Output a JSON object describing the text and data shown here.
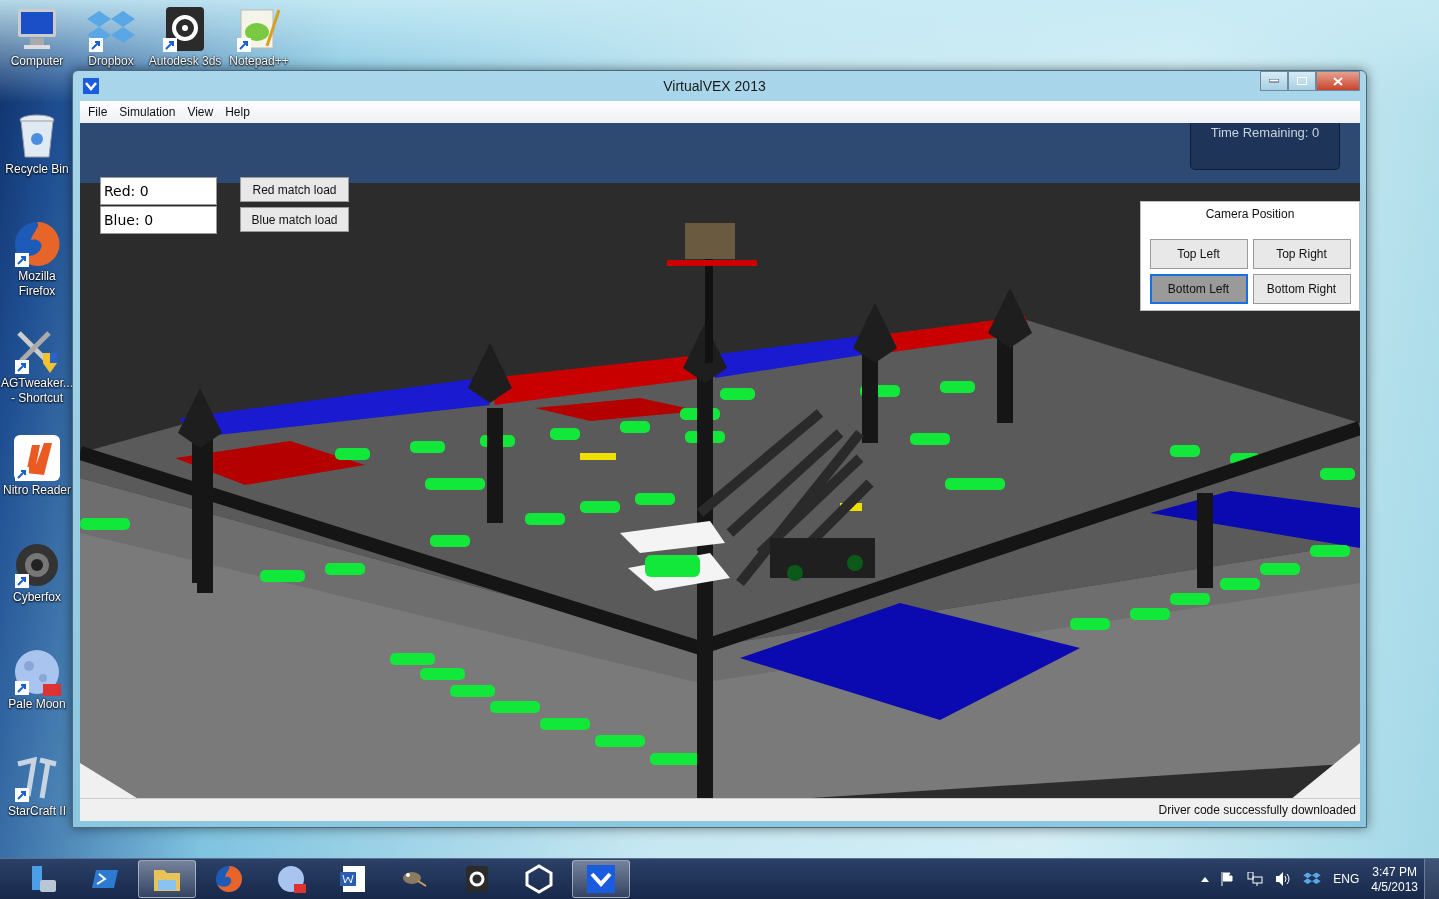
{
  "desktop": {
    "top_icons": [
      {
        "label": "Computer",
        "kind": "computer",
        "shortcut": false
      },
      {
        "label": "Dropbox",
        "kind": "dropbox",
        "shortcut": true
      },
      {
        "label": "Autodesk 3ds",
        "kind": "max3ds",
        "shortcut": true
      },
      {
        "label": "Notepad++",
        "kind": "notepad",
        "shortcut": true
      }
    ],
    "side_icons": [
      {
        "label": "Recycle Bin",
        "kind": "recycle",
        "shortcut": false
      },
      {
        "label": "Mozilla Firefox",
        "kind": "firefox",
        "shortcut": true
      },
      {
        "label": "AGTweaker... - Shortcut",
        "kind": "tools",
        "shortcut": true
      },
      {
        "label": "Nitro Reader",
        "kind": "nitro",
        "shortcut": true
      },
      {
        "label": "Cyberfox",
        "kind": "cyberfox",
        "shortcut": true
      },
      {
        "label": "Pale Moon",
        "kind": "moon",
        "shortcut": true
      },
      {
        "label": "StarCraft II",
        "kind": "starcraft",
        "shortcut": true
      }
    ]
  },
  "window": {
    "title": "VirtualVEX 2013",
    "menu": [
      "File",
      "Simulation",
      "View",
      "Help"
    ],
    "scores": [
      "Red: 0",
      "Blue: 0"
    ],
    "load_buttons": [
      "Red match load",
      "Blue match load"
    ],
    "timer": "Time Remaining: 0",
    "camera": {
      "title": "Camera Position",
      "buttons": [
        {
          "label": "Top Left",
          "selected": false
        },
        {
          "label": "Top Right",
          "selected": false
        },
        {
          "label": "Bottom Left",
          "selected": true
        },
        {
          "label": "Bottom Right",
          "selected": false
        }
      ]
    },
    "status": "Driver code successfully downloaded"
  },
  "taskbar": {
    "items": [
      {
        "kind": "server",
        "active": false
      },
      {
        "kind": "shell",
        "active": false
      },
      {
        "kind": "folder",
        "active": true
      },
      {
        "kind": "firefox",
        "active": false
      },
      {
        "kind": "moon",
        "active": false
      },
      {
        "kind": "word",
        "active": false
      },
      {
        "kind": "gimp",
        "active": false
      },
      {
        "kind": "max3ds",
        "active": false
      },
      {
        "kind": "unity",
        "active": false
      },
      {
        "kind": "vex",
        "active": true
      }
    ],
    "language": "ENG",
    "time": "3:47 PM",
    "date": "4/5/2013"
  }
}
